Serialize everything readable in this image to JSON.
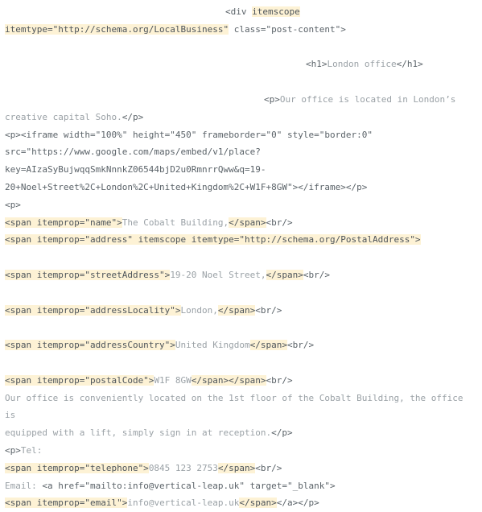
{
  "document": {
    "type": "html-source-listing",
    "background_color": "#ffffff",
    "highlight_color": "#fdf2d5",
    "tag_text_color": "#5a6268",
    "content_text_color": "#9aa1a6",
    "lines": [
      {
        "id": "l1",
        "indent": "indent-1",
        "segments": [
          {
            "text": "<div ",
            "style": "tag"
          },
          {
            "text": "itemscope",
            "style": "hl"
          }
        ]
      },
      {
        "id": "l2",
        "indent": "none",
        "segments": [
          {
            "text": "itemtype=\"http://schema.org/LocalBusiness\"",
            "style": "hl"
          },
          {
            "text": " class=\"post-content\">",
            "style": "tag"
          }
        ]
      },
      {
        "id": "l3",
        "indent": "none",
        "segments": []
      },
      {
        "id": "l4",
        "indent": "indent-2",
        "segments": [
          {
            "text": "<h1>",
            "style": "tag"
          },
          {
            "text": "London office",
            "style": "content"
          },
          {
            "text": "</h1>",
            "style": "tag"
          }
        ]
      },
      {
        "id": "l5",
        "indent": "none",
        "segments": []
      },
      {
        "id": "l6",
        "indent": "indent-3",
        "segments": [
          {
            "text": "<p>",
            "style": "tag"
          },
          {
            "text": "Our office is located in London’s",
            "style": "content"
          }
        ]
      },
      {
        "id": "l7",
        "indent": "none",
        "segments": [
          {
            "text": "creative capital Soho.",
            "style": "content"
          },
          {
            "text": "</p>",
            "style": "tag"
          }
        ]
      },
      {
        "id": "l8",
        "indent": "none",
        "segments": [
          {
            "text": "<p><iframe width=\"100%\" height=\"450\" frameborder=\"0\" style=\"border:0\"",
            "style": "tag"
          }
        ]
      },
      {
        "id": "l9",
        "indent": "none",
        "segments": [
          {
            "text": "src=\"https://www.google.com/maps/embed/v1/place?",
            "style": "tag"
          }
        ]
      },
      {
        "id": "l10",
        "indent": "none",
        "segments": [
          {
            "text": "key=AIzaSyBujwqqSmkNnnkZ06544bjD2u0RmnrrQww&q=19-",
            "style": "tag"
          }
        ]
      },
      {
        "id": "l11",
        "indent": "none",
        "segments": [
          {
            "text": "20+Noel+Street%2C+London%2C+United+Kingdom%2C+W1F+8GW\"></iframe></p>",
            "style": "tag"
          }
        ]
      },
      {
        "id": "l12",
        "indent": "none",
        "segments": [
          {
            "text": "<p>",
            "style": "tag"
          }
        ]
      },
      {
        "id": "l13",
        "indent": "none",
        "segments": [
          {
            "text": "<span itemprop=\"name\">",
            "style": "hl"
          },
          {
            "text": "The Cobalt Building,",
            "style": "content"
          },
          {
            "text": "</span>",
            "style": "hl"
          },
          {
            "text": "<br/>",
            "style": "tag"
          }
        ]
      },
      {
        "id": "l14",
        "indent": "none",
        "segments": [
          {
            "text": "<span itemprop=\"address\" itemscope itemtype=\"http://schema.org/PostalAddress\">",
            "style": "hl"
          }
        ]
      },
      {
        "id": "l15",
        "indent": "none",
        "segments": []
      },
      {
        "id": "l16",
        "indent": "none",
        "segments": [
          {
            "text": "<span itemprop=\"streetAddress\">",
            "style": "hl"
          },
          {
            "text": "19-20 Noel Street,",
            "style": "content"
          },
          {
            "text": "</span>",
            "style": "hl"
          },
          {
            "text": "<br/>",
            "style": "tag"
          }
        ]
      },
      {
        "id": "l17",
        "indent": "none",
        "segments": []
      },
      {
        "id": "l18",
        "indent": "none",
        "segments": [
          {
            "text": "<span itemprop=\"addressLocality\">",
            "style": "hl"
          },
          {
            "text": "London,",
            "style": "content"
          },
          {
            "text": "</span>",
            "style": "hl"
          },
          {
            "text": "<br/>",
            "style": "tag"
          }
        ]
      },
      {
        "id": "l19",
        "indent": "none",
        "segments": []
      },
      {
        "id": "l20",
        "indent": "none",
        "segments": [
          {
            "text": "<span itemprop=\"addressCountry\">",
            "style": "hl"
          },
          {
            "text": "United Kingdom",
            "style": "content"
          },
          {
            "text": "</span>",
            "style": "hl"
          },
          {
            "text": "<br/>",
            "style": "tag"
          }
        ]
      },
      {
        "id": "l21",
        "indent": "none",
        "segments": []
      },
      {
        "id": "l22",
        "indent": "none",
        "segments": [
          {
            "text": "<span itemprop=\"postalCode\">",
            "style": "hl"
          },
          {
            "text": "W1F 8GW",
            "style": "content"
          },
          {
            "text": "</span></span>",
            "style": "hl"
          },
          {
            "text": "<br/>",
            "style": "tag"
          }
        ]
      },
      {
        "id": "l23",
        "indent": "none",
        "segments": [
          {
            "text": "Our office is conveniently located on the 1st floor of the Cobalt Building, the office is",
            "style": "content"
          }
        ]
      },
      {
        "id": "l24",
        "indent": "none",
        "segments": [
          {
            "text": "equipped with a lift, simply sign in at reception.",
            "style": "content"
          },
          {
            "text": "</p>",
            "style": "tag"
          }
        ]
      },
      {
        "id": "l25",
        "indent": "none",
        "segments": [
          {
            "text": "<p>",
            "style": "tag"
          },
          {
            "text": "Tel:",
            "style": "content"
          }
        ]
      },
      {
        "id": "l26",
        "indent": "none",
        "segments": [
          {
            "text": "<span itemprop=\"telephone\">",
            "style": "hl"
          },
          {
            "text": "0845 123 2753",
            "style": "content"
          },
          {
            "text": "</span>",
            "style": "hl"
          },
          {
            "text": "<br/>",
            "style": "tag"
          }
        ]
      },
      {
        "id": "l27",
        "indent": "none",
        "segments": [
          {
            "text": "Email: ",
            "style": "content"
          },
          {
            "text": "<a href=\"mailto:info@vertical-leap.uk\" target=\"_blank\">",
            "style": "tag"
          }
        ]
      },
      {
        "id": "l28",
        "indent": "none",
        "segments": [
          {
            "text": "<span itemprop=\"email\">",
            "style": "hl"
          },
          {
            "text": "info@vertical-leap.uk",
            "style": "content"
          },
          {
            "text": "</span>",
            "style": "hl"
          },
          {
            "text": "</a></p>",
            "style": "tag"
          }
        ]
      }
    ]
  },
  "extracted_microdata": {
    "itemtype": "http://schema.org/LocalBusiness",
    "name": "The Cobalt Building,",
    "address_itemtype": "http://schema.org/PostalAddress",
    "streetAddress": "19-20 Noel Street,",
    "addressLocality": "London,",
    "addressCountry": "United Kingdom",
    "postalCode": "W1F 8GW",
    "telephone": "0845 123 2753",
    "email": "info@vertical-leap.uk",
    "heading": "London office",
    "maps_api_key": "AIzaSyBujwqqSmkNnnkZ06544bjD2u0RmnrrQww"
  }
}
